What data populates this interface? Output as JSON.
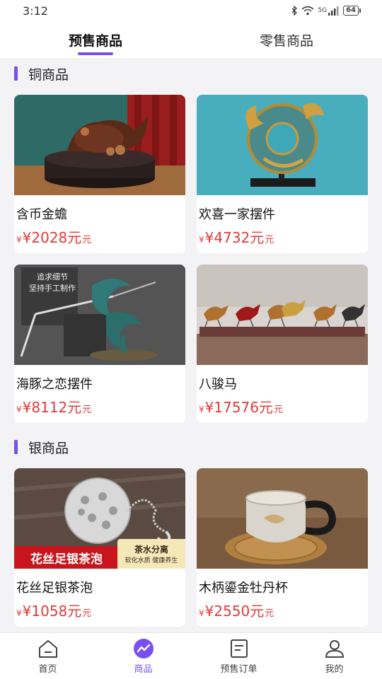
{
  "status": {
    "time": "3:12",
    "network": "5G",
    "battery": "64"
  },
  "tabs": [
    {
      "label": "预售商品",
      "active": true
    },
    {
      "label": "零售商品",
      "active": false
    }
  ],
  "sections": [
    {
      "title": "铜商品",
      "items": [
        {
          "name": "含币金蟾",
          "price_prefix": "¥",
          "price_amount": "¥2028元",
          "price_suffix": "元"
        },
        {
          "name": "欢喜一家摆件",
          "price_prefix": "¥",
          "price_amount": "¥4732元",
          "price_suffix": "元"
        },
        {
          "name": "海豚之恋摆件",
          "price_prefix": "¥",
          "price_amount": "¥8112元",
          "price_suffix": "元",
          "image_text": [
            "追求细节",
            "坚持手工制作"
          ]
        },
        {
          "name": "八骏马",
          "price_prefix": "¥",
          "price_amount": "¥17576元",
          "price_suffix": "元"
        }
      ]
    },
    {
      "title": "银商品",
      "items": [
        {
          "name": "花丝足银茶泡",
          "price_prefix": "¥",
          "price_amount": "¥1058元",
          "price_suffix": "元",
          "image_text": [
            "花丝足银茶泡",
            "茶水分离",
            "软化水质 健康养生"
          ]
        },
        {
          "name": "木柄鎏金牡丹杯",
          "price_prefix": "¥",
          "price_amount": "¥2550元",
          "price_suffix": "元"
        }
      ]
    }
  ],
  "bottom_nav": [
    {
      "label": "首页",
      "icon": "home-icon",
      "active": false
    },
    {
      "label": "商品",
      "icon": "trend-icon",
      "active": true
    },
    {
      "label": "预售订单",
      "icon": "order-icon",
      "active": false
    },
    {
      "label": "我的",
      "icon": "user-icon",
      "active": false
    }
  ],
  "colors": {
    "accent": "#7a4ff0",
    "price": "#e23a3a",
    "background": "#f3f3f5"
  }
}
